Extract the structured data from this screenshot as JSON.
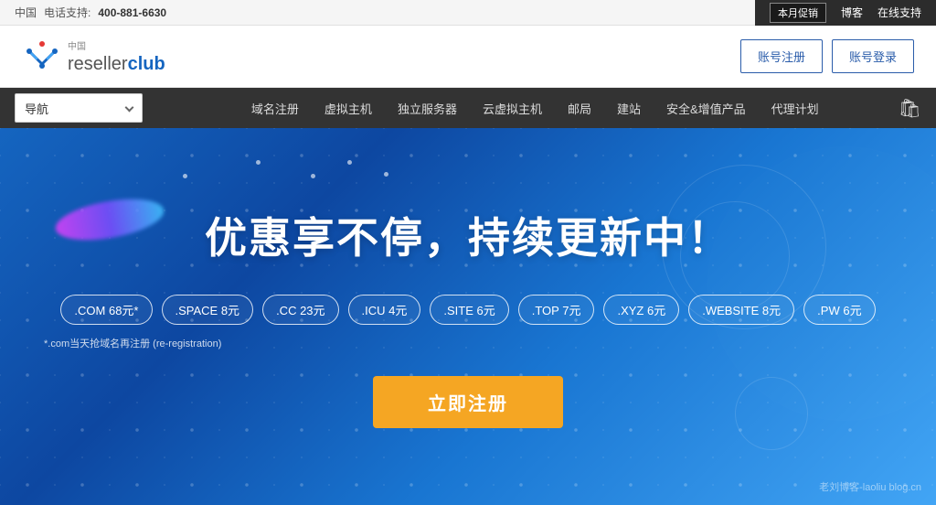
{
  "topbar": {
    "region": "中国",
    "phone_label": "电话支持:",
    "phone": "400-881-6630",
    "promo": "本月促销",
    "blog": "博客",
    "support": "在线支持"
  },
  "header": {
    "logo_cn": "中国",
    "logo_brand": "reseller",
    "logo_bold": "club",
    "btn_register": "账号注册",
    "btn_login": "账号登录"
  },
  "nav": {
    "dropdown_label": "导航",
    "links": [
      "域名注册",
      "虚拟主机",
      "独立服务器",
      "云虚拟主机",
      "邮局",
      "建站",
      "安全&增值产品",
      "代理计划"
    ]
  },
  "hero": {
    "title": "优惠享不停，持续更新中！",
    "tags": [
      ".COM 68元*",
      ".SPACE 8元",
      ".CC 23元",
      ".ICU 4元",
      ".SITE 6元",
      ".TOP 7元",
      ".XYZ 6元",
      ".WEBSITE 8元",
      ".PW 6元"
    ],
    "note": "*.com当天抢域名再注册 (re-registration)",
    "cta": "立即注册",
    "watermark": "老刘博客-laoliu blog.cn"
  }
}
